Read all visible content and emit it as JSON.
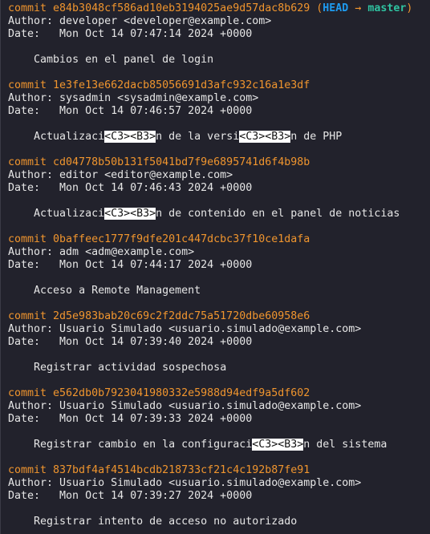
{
  "theme": {
    "hash_color": "#f0952e",
    "head_color": "#1e9bf0",
    "branch_color": "#2fc2a0"
  },
  "refs": {
    "head": "HEAD",
    "arrow": "→",
    "branch": "master"
  },
  "labels": {
    "commit": "commit",
    "author": "Author:",
    "date": "Date:"
  },
  "commits": [
    {
      "hash": "e84b3048cf586ad10eb3194025ae9d57dac8b629",
      "refs": true,
      "author": "developer <developer@example.com>",
      "date": "Mon Oct 14 07:47:14 2024 +0000",
      "message": [
        {
          "t": "Cambios en el panel de login"
        }
      ]
    },
    {
      "hash": "1e3fe13e662dacb85056691d3afc932c16a1e3df",
      "author": "sysadmin <sysadmin@example.com>",
      "date": "Mon Oct 14 07:46:57 2024 +0000",
      "message": [
        {
          "t": "Actualizaci"
        },
        {
          "t": "<C3><B3>",
          "hl": true
        },
        {
          "t": "n de la versi"
        },
        {
          "t": "<C3><B3>",
          "hl": true
        },
        {
          "t": "n de PHP"
        }
      ]
    },
    {
      "hash": "cd04778b50b131f5041bd7f9e6895741d6f4b98b",
      "author": "editor <editor@example.com>",
      "date": "Mon Oct 14 07:46:43 2024 +0000",
      "message": [
        {
          "t": "Actualizaci"
        },
        {
          "t": "<C3><B3>",
          "hl": true
        },
        {
          "t": "n de contenido en el panel de noticias"
        }
      ]
    },
    {
      "hash": "0baffeec1777f9dfe201c447dcbc37f10ce1dafa",
      "author": "adm <adm@example.com>",
      "date": "Mon Oct 14 07:44:17 2024 +0000",
      "message": [
        {
          "t": "Acceso a Remote Management"
        }
      ]
    },
    {
      "hash": "2d5e983bab20c69c2f2ddc75a51720dbe60958e6",
      "author": "Usuario Simulado <usuario.simulado@example.com>",
      "date": "Mon Oct 14 07:39:40 2024 +0000",
      "message": [
        {
          "t": "Registrar actividad sospechosa"
        }
      ]
    },
    {
      "hash": "e562db0b7923041980332e5988d94edf9a5df602",
      "author": "Usuario Simulado <usuario.simulado@example.com>",
      "date": "Mon Oct 14 07:39:33 2024 +0000",
      "message": [
        {
          "t": "Registrar cambio en la configuraci"
        },
        {
          "t": "<C3><B3>",
          "hl": true
        },
        {
          "t": "n del sistema"
        }
      ]
    },
    {
      "hash": "837bdf4af4514bcdb218733cf21c4c192b87fe91",
      "author": "Usuario Simulado <usuario.simulado@example.com>",
      "date": "Mon Oct 14 07:39:27 2024 +0000",
      "message": [
        {
          "t": "Registrar intento de acceso no autorizado"
        }
      ]
    }
  ]
}
